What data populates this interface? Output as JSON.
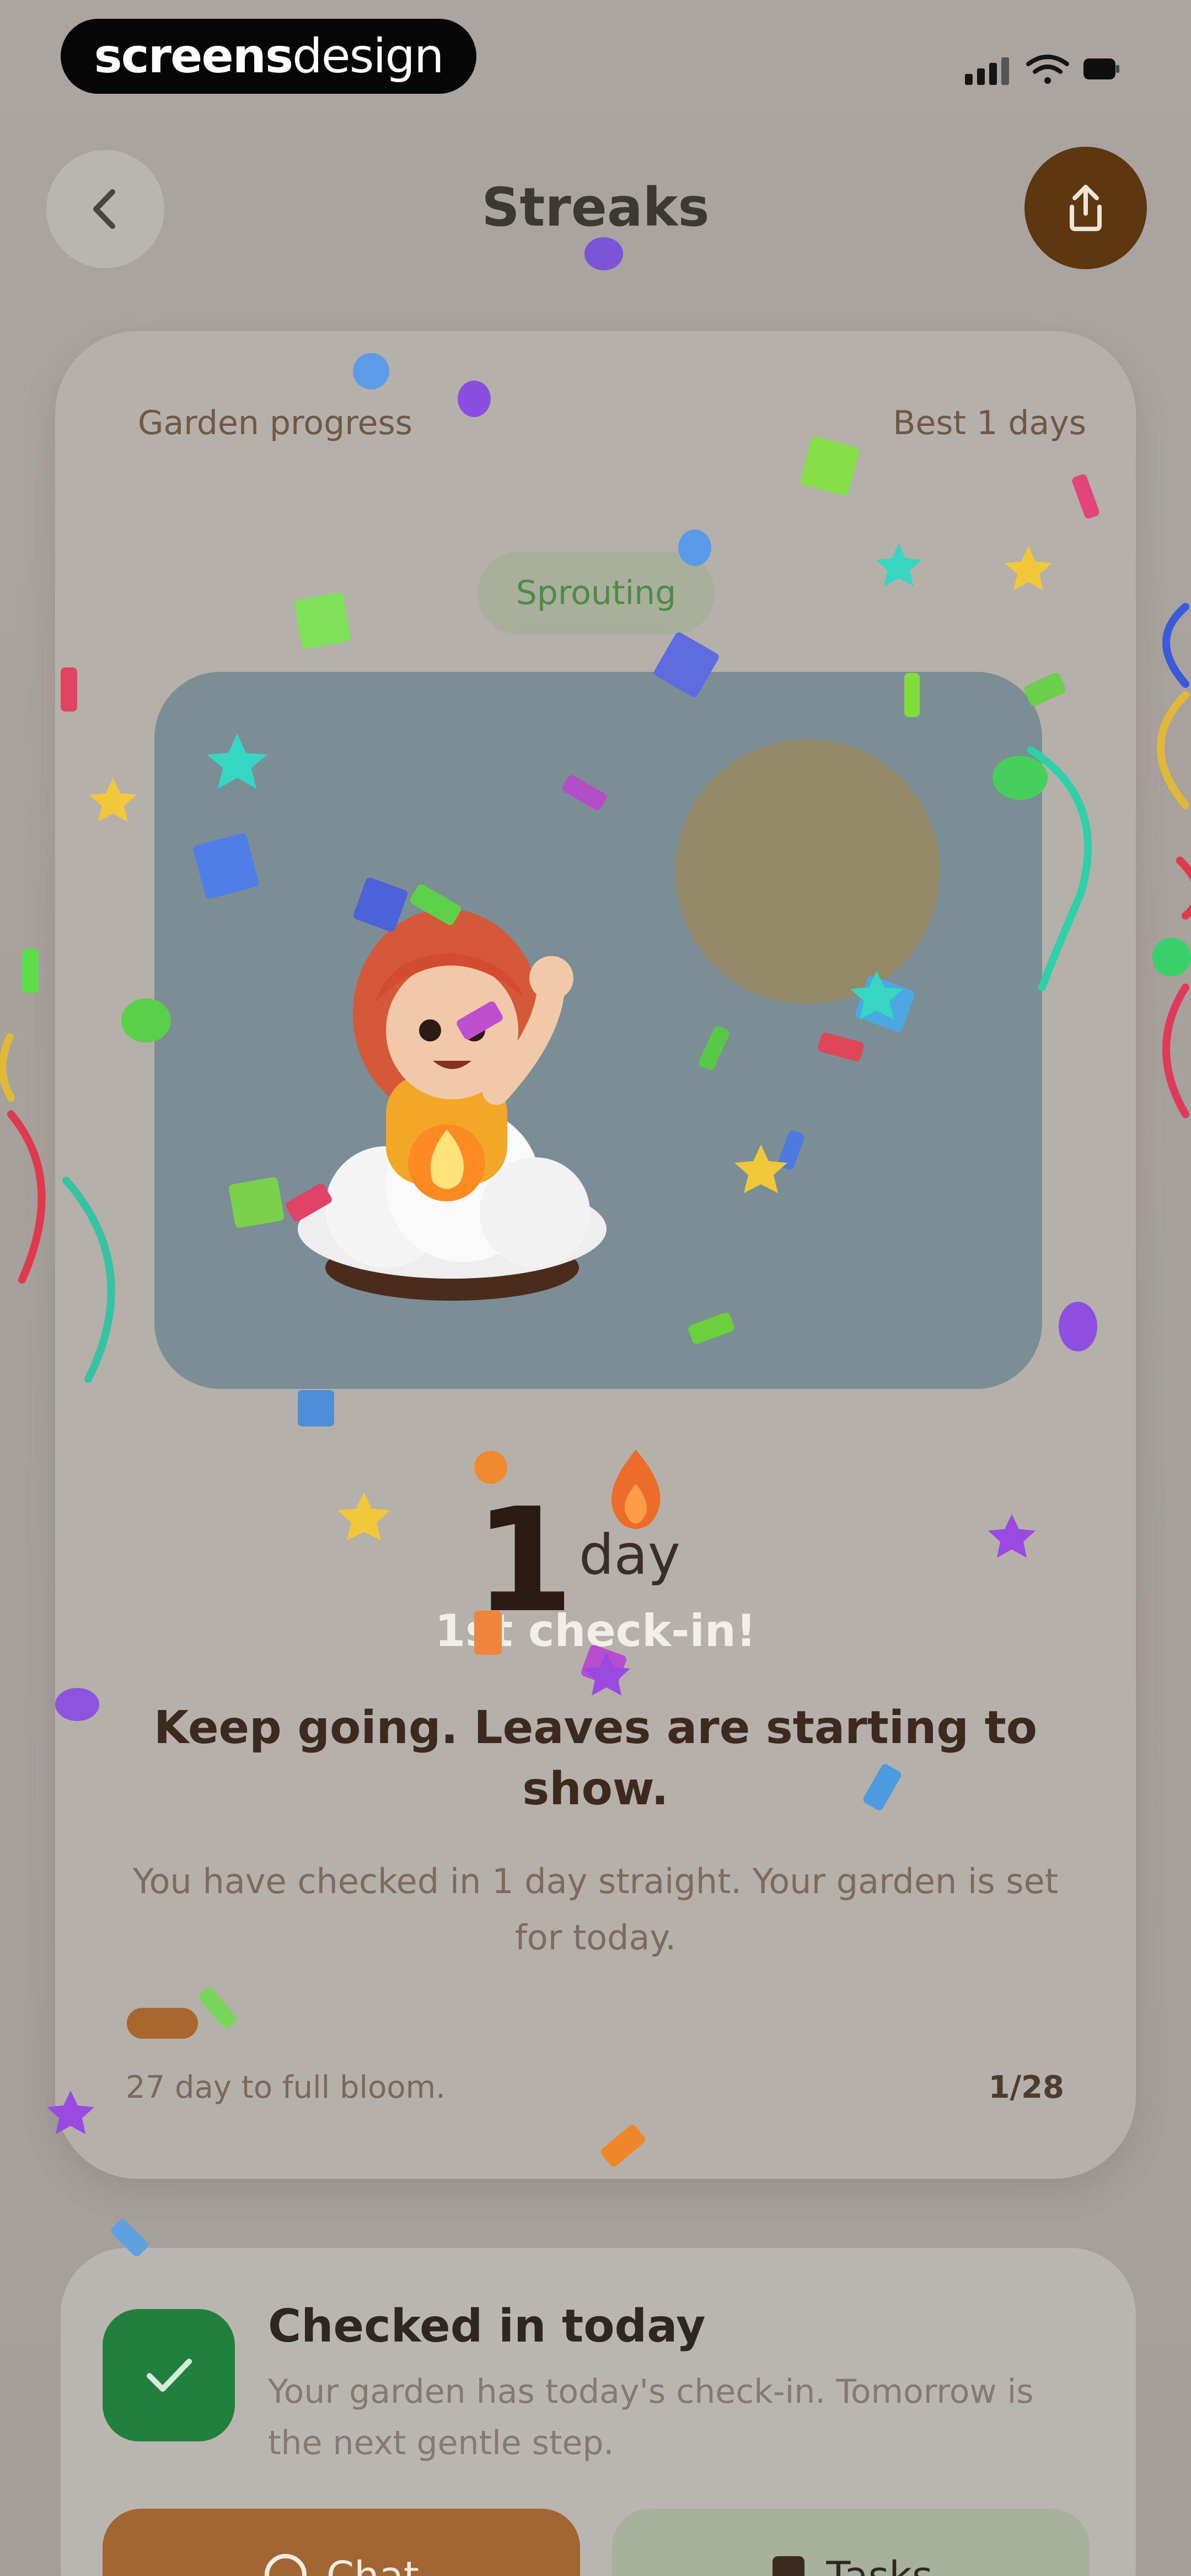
{
  "status_bar": {
    "brand_bold": "screens",
    "brand_thin": "design",
    "icons": [
      "cellular-signal-icon",
      "wifi-icon",
      "battery-icon"
    ]
  },
  "header": {
    "title": "Streaks",
    "back_icon": "chevron-left-icon",
    "share_icon": "share-icon"
  },
  "garden": {
    "label": "Garden progress",
    "best": "Best 1 days",
    "stage": "Sprouting",
    "illustration": "girl-on-cloud-with-flame",
    "day_number": "1",
    "day_unit": "day",
    "checkin_note": "1st check-in!",
    "headline": "Keep going. Leaves are starting to show.",
    "description": "You have checked in 1 day straight. Your garden is set for today.",
    "progress_fraction": 0.036,
    "to_bloom": "27 day to full bloom.",
    "progress_count": "1/28"
  },
  "checkin": {
    "title": "Checked in today",
    "text": "Your garden has today's check-in. Tomorrow is the next gentle step.",
    "chat_label": "Chat",
    "tasks_label": "Tasks"
  },
  "colors": {
    "accent_brown": "#a8682d",
    "success_green": "#22803e",
    "share_button": "#5e3710"
  }
}
